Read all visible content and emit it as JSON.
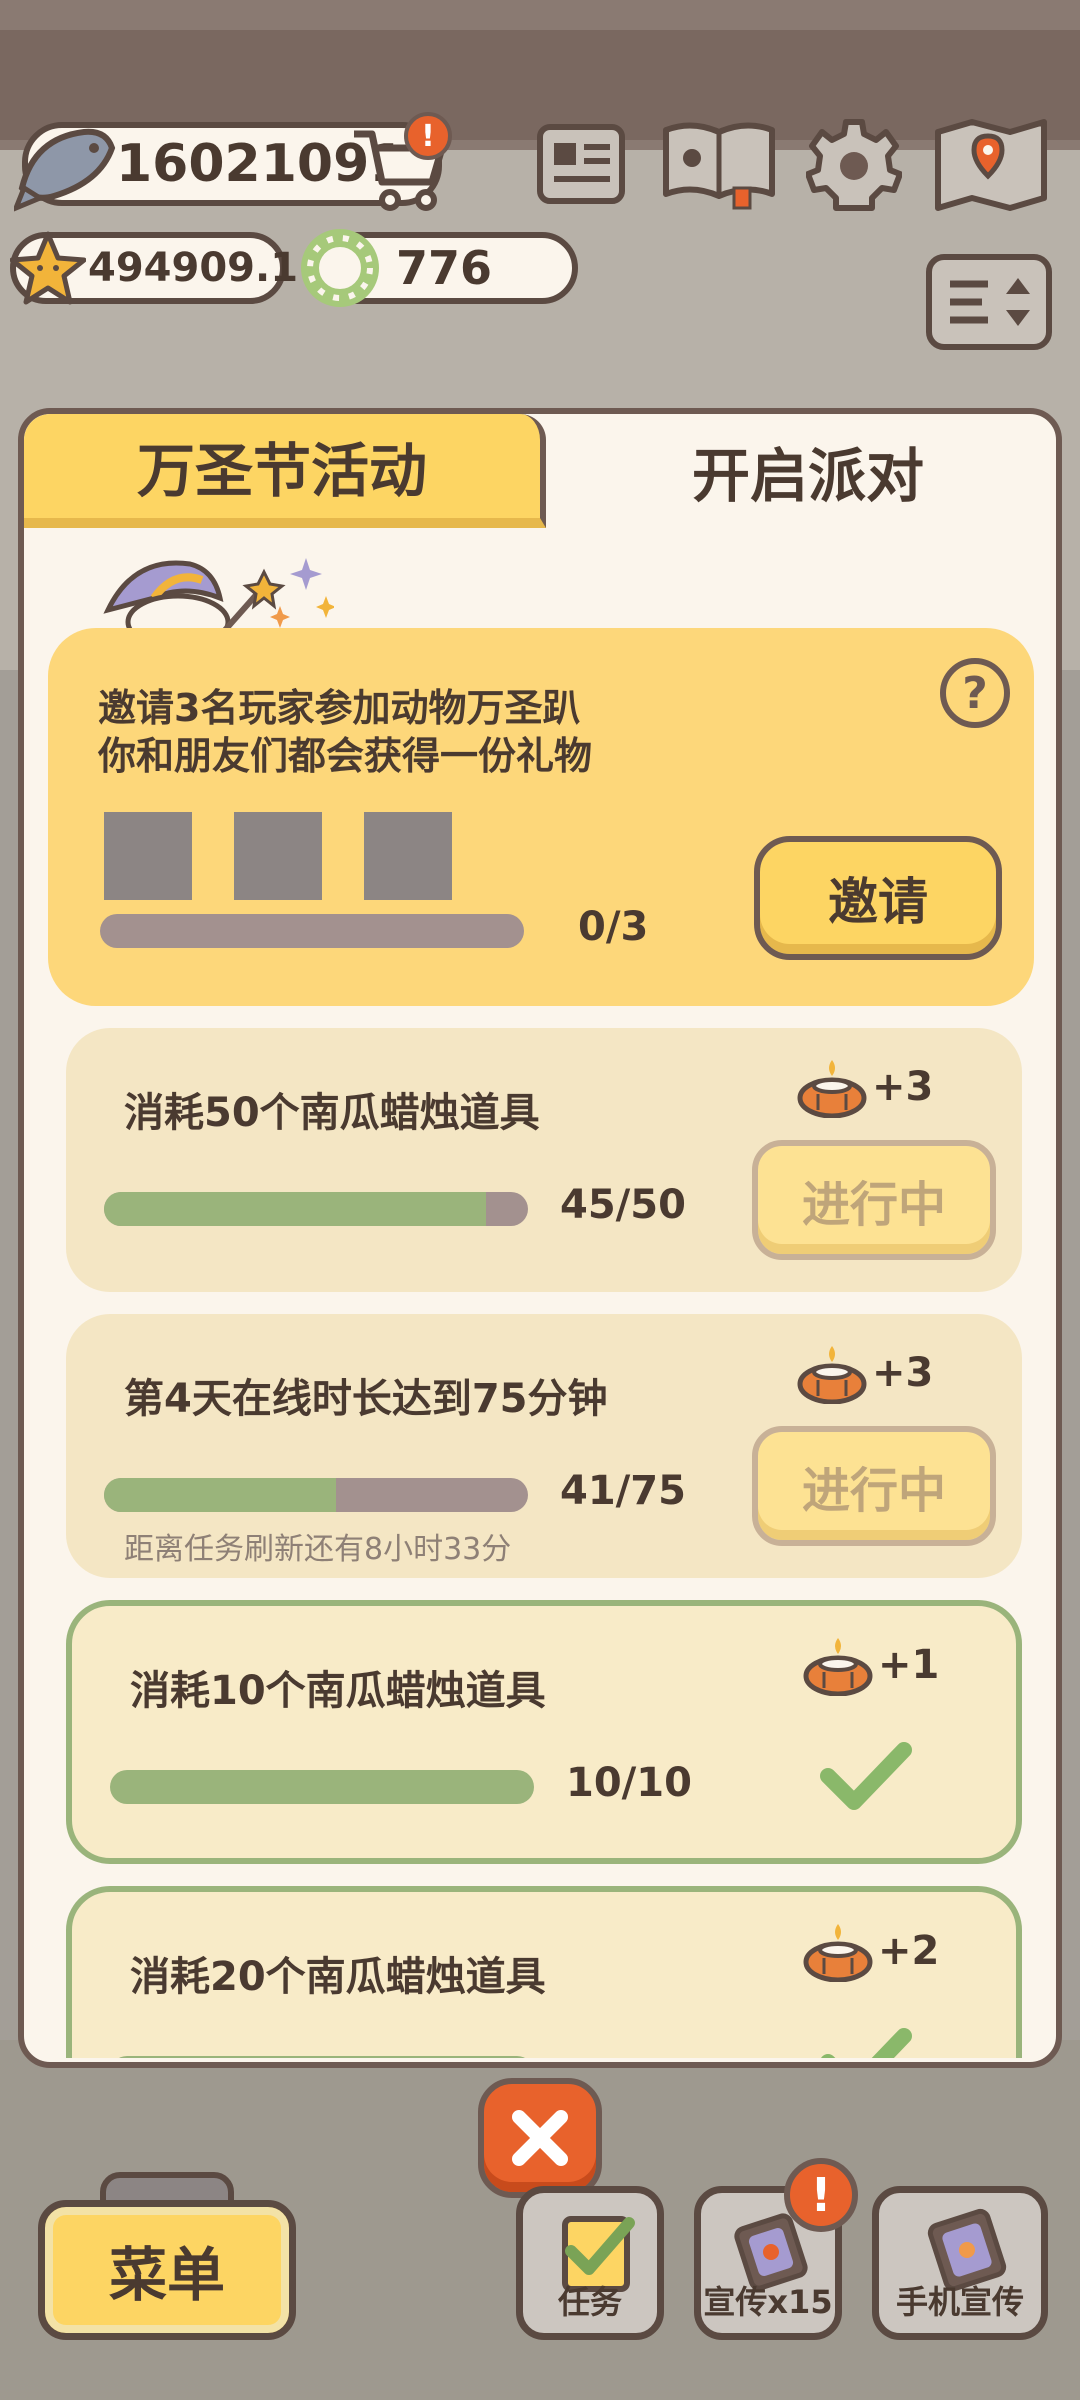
{
  "hud": {
    "fish_currency": "16021091",
    "star_currency": "494909.1",
    "ring_currency": "776",
    "icons": [
      "fish-icon",
      "cart-icon",
      "alert-icon",
      "newspaper-icon",
      "paw-book-icon",
      "gear-icon",
      "map-icon",
      "sort-icon",
      "star-icon",
      "ring-icon"
    ]
  },
  "tabs": {
    "left": "万圣节活动",
    "right": "开启派对"
  },
  "invite": {
    "text_line1": "邀请3名玩家参加动物万圣趴",
    "text_line2": "你和朋友们都会获得一份礼物",
    "progress_text": "0/3",
    "progress": 0.0,
    "help": "?",
    "button": "邀请"
  },
  "tasks": [
    {
      "title": "消耗50个南瓜蜡烛道具",
      "reward": "+3",
      "progress_text": "45/50",
      "progress": 0.9,
      "button": "进行中",
      "done": false,
      "note": ""
    },
    {
      "title": "第4天在线时长达到75分钟",
      "reward": "+3",
      "progress_text": "41/75",
      "progress": 0.547,
      "button": "进行中",
      "done": false,
      "note": "距离任务刷新还有8小时33分"
    },
    {
      "title": "消耗10个南瓜蜡烛道具",
      "reward": "+1",
      "progress_text": "10/10",
      "progress": 1.0,
      "button": "",
      "done": true,
      "note": ""
    },
    {
      "title": "消耗20个南瓜蜡烛道具",
      "reward": "+2",
      "progress_text": "",
      "progress": 1.0,
      "button": "",
      "done": true,
      "note": ""
    }
  ],
  "bottom": {
    "close": "×",
    "menu": "菜单",
    "tasks_btn": "任务",
    "promo_btn": "宣传x15",
    "phone_promo_btn": "手机宣传",
    "alert": "!"
  },
  "colors": {
    "accent_yellow": "#fdd563",
    "progress_green": "#9ab47b",
    "close_orange": "#e8622c",
    "outline_brown": "#5b4a42"
  }
}
